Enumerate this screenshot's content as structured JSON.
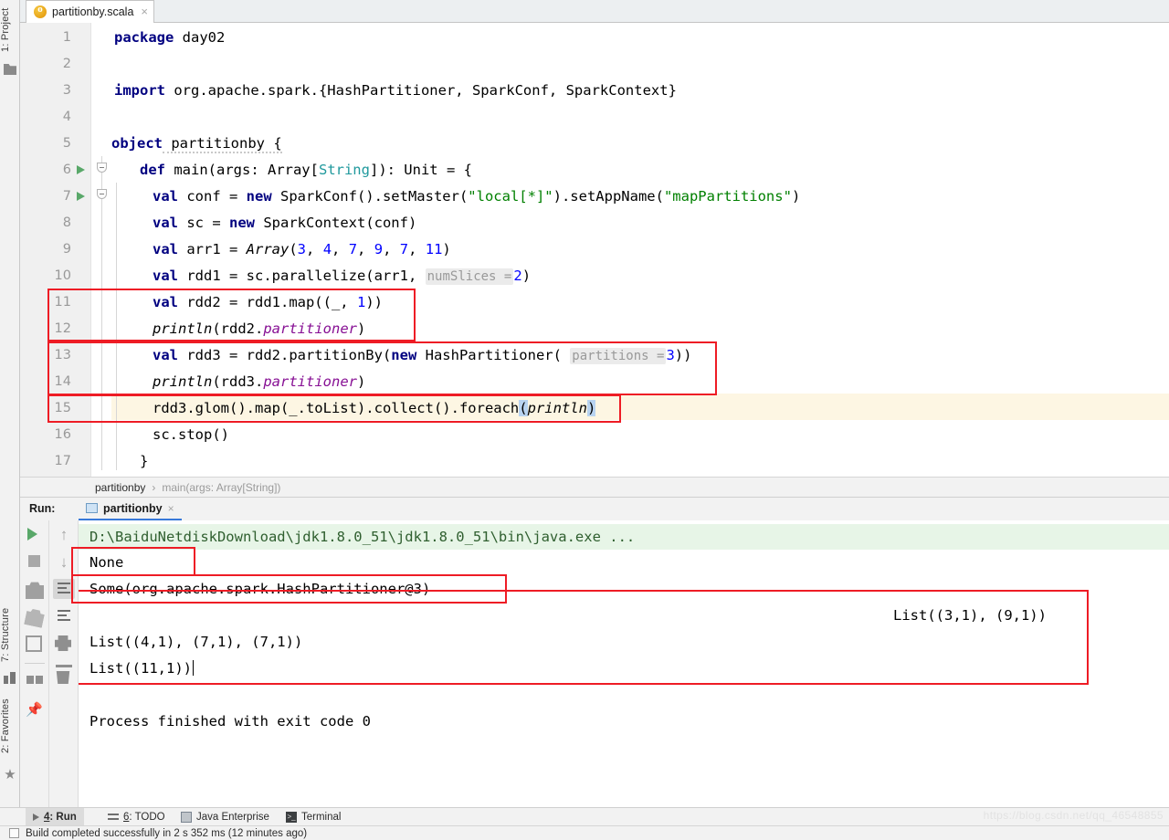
{
  "window": {
    "file_tab": {
      "label": "partitionby.scala",
      "icon": "scala-file-icon",
      "close": "×"
    }
  },
  "sidebar": {
    "tabs": [
      {
        "label": "1: Project",
        "icon": "folder-icon"
      },
      {
        "label": "7: Structure",
        "icon": "structure-icon"
      },
      {
        "label": "2: Favorites",
        "icon": "star-icon"
      }
    ]
  },
  "editor": {
    "lines": [
      {
        "n": "1",
        "indent": 0
      },
      {
        "n": "2",
        "indent": 0
      },
      {
        "n": "3",
        "indent": 0
      },
      {
        "n": "4",
        "indent": 0
      },
      {
        "n": "5",
        "indent": 0
      },
      {
        "n": "6",
        "indent": 0
      },
      {
        "n": "7",
        "indent": 0
      },
      {
        "n": "8",
        "indent": 0
      },
      {
        "n": "9",
        "indent": 0
      },
      {
        "n": "10",
        "indent": 0
      },
      {
        "n": "11",
        "indent": 0
      },
      {
        "n": "12",
        "indent": 0
      },
      {
        "n": "13",
        "indent": 0
      },
      {
        "n": "14",
        "indent": 0
      },
      {
        "n": "15",
        "indent": 0
      },
      {
        "n": "16",
        "indent": 0
      },
      {
        "n": "17",
        "indent": 0
      }
    ],
    "code": {
      "l1_kw": "package",
      "l1_rest": " day02",
      "l3_kw": "import",
      "l3_rest": " org.apache.spark.{HashPartitioner, SparkConf, SparkContext}",
      "l5_kw": "object",
      "l5_rest": " partitionby {",
      "l6_kw": "def",
      "l6_a": " main(args: Array[",
      "l6_type": "String",
      "l6_b": "]): Unit = {",
      "l7_kw": "val",
      "l7_a": " conf = ",
      "l7_kw2": "new",
      "l7_b": " SparkConf().setMaster(",
      "l7_s1": "\"local[*]\"",
      "l7_c": ").setAppName(",
      "l7_s2": "\"mapPartitions\"",
      "l7_d": ")",
      "l8_kw": "val",
      "l8_a": " sc = ",
      "l8_kw2": "new",
      "l8_b": " SparkContext(conf)",
      "l9_kw": "val",
      "l9_a": " arr1 = ",
      "l9_cls": "Array",
      "l9_b": "(",
      "l9_n1": "3",
      "l9_s1": ", ",
      "l9_n2": "4",
      "l9_s2": ", ",
      "l9_n3": "7",
      "l9_s3": ", ",
      "l9_n4": "9",
      "l9_s4": ", ",
      "l9_n5": "7",
      "l9_s5": ", ",
      "l9_n6": "11",
      "l9_c": ")",
      "l10_kw": "val",
      "l10_a": " rdd1 = sc.parallelize(arr1, ",
      "l10_hint": "numSlices =",
      "l10_n": "2",
      "l10_b": ")",
      "l11_kw": "val",
      "l11_a": " rdd2 = rdd1.map((_, ",
      "l11_n": "1",
      "l11_b": "))",
      "l12_fn": "println",
      "l12_a": "(rdd2.",
      "l12_field": "partitioner",
      "l12_b": ")",
      "l13_kw": "val",
      "l13_a": " rdd3 = rdd2.partitionBy(",
      "l13_kw2": "new",
      "l13_b": " HashPartitioner( ",
      "l13_hint": "partitions =",
      "l13_n": "3",
      "l13_c": "))",
      "l14_fn": "println",
      "l14_a": "(rdd3.",
      "l14_field": "partitioner",
      "l14_b": ")",
      "l15_a": "rdd3.glom().map(_.toList).collect().foreach",
      "l15_p1": "(",
      "l15_fn": "println",
      "l15_p2": ")",
      "l16": "sc.stop()",
      "l17": "}"
    }
  },
  "breadcrumb": {
    "root": "partitionby",
    "separator": "›",
    "leaf": "main(args: Array[String])"
  },
  "run_window": {
    "label": "Run:",
    "tab_name": "partitionby",
    "tab_close": "×",
    "toolbar_left": [
      {
        "name": "rerun-button",
        "icon": "play-icon"
      },
      {
        "name": "stop-button",
        "icon": "stop-square-icon"
      },
      {
        "name": "screenshot-button",
        "icon": "camera-icon"
      },
      {
        "name": "restore-layout-button",
        "icon": "restore-icon"
      },
      {
        "name": "export-button",
        "icon": "export-icon"
      },
      {
        "name": "layout-button",
        "icon": "layout-icon"
      },
      {
        "name": "pin-button",
        "icon": "pin-icon"
      }
    ],
    "toolbar_right": [
      {
        "name": "up-button",
        "icon": "arrow-up-icon"
      },
      {
        "name": "down-button",
        "icon": "arrow-down-icon"
      },
      {
        "name": "soft-wrap-button",
        "icon": "soft-wrap-icon"
      },
      {
        "name": "scroll-to-end-button",
        "icon": "scroll-end-icon"
      },
      {
        "name": "print-button",
        "icon": "printer-icon"
      },
      {
        "name": "clear-all-button",
        "icon": "trash-icon"
      }
    ],
    "console": {
      "command": "D:\\BaiduNetdiskDownload\\jdk1.8.0_51\\jdk1.8.0_51\\bin\\java.exe ...",
      "out_none": "None",
      "out_some": "Some(org.apache.spark.HashPartitioner@3)",
      "out_list_right": "List((3,1), (9,1))",
      "out_list_2": "List((4,1), (7,1), (7,1))",
      "out_list_3": "List((11,1))",
      "out_exit": "Process finished with exit code 0"
    }
  },
  "bottom_bar": {
    "items": [
      {
        "label": "4: Run",
        "mnemonic": "4",
        "rest": ": Run",
        "icon": "play-icon",
        "active": true
      },
      {
        "label": "6: TODO",
        "mnemonic": "6",
        "rest": ": TODO",
        "icon": "todo-icon",
        "active": false
      },
      {
        "label": "Java Enterprise",
        "icon": "java-enterprise-icon",
        "active": false
      },
      {
        "label": "Terminal",
        "icon": "terminal-icon",
        "active": false
      }
    ]
  },
  "status_bar": {
    "message": "Build completed successfully in 2 s 352 ms (12 minutes ago)",
    "icon": "build-icon"
  },
  "watermark": {
    "text": "https://blog.csdn.net/qq_46548855"
  },
  "colors": {
    "keyword": "#000080",
    "string": "#008000",
    "number": "#0000ff",
    "type": "#20999d",
    "field": "#871094",
    "annotation_box": "#ee1c25",
    "accent": "#3879d9",
    "run_green": "#59a869",
    "current_line": "#fdf6e3"
  }
}
